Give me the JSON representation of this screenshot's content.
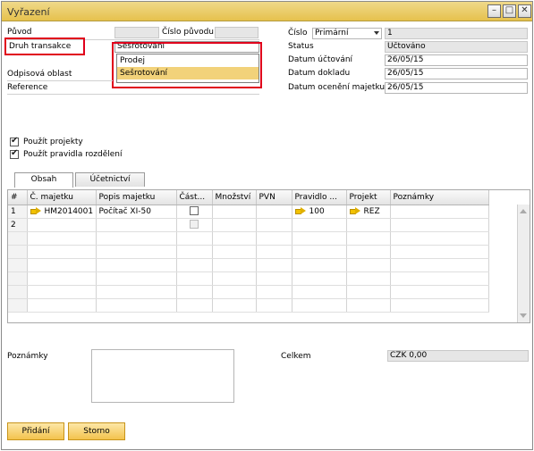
{
  "window": {
    "title": "Vyřazení"
  },
  "header": {
    "puvod_label": "Původ",
    "cislo_puvodu_label": "Číslo původu",
    "druh_transakce_label": "Druh transakce",
    "druh_transakce_value": "Sešrotování",
    "odpisova_oblast_label": "Odpisová oblast",
    "reference_label": "Reference",
    "cislo_label": "Číslo",
    "cislo_series": "Primární",
    "cislo_value": "1",
    "status_label": "Status",
    "status_value": "Účtováno",
    "datum_uctovani_label": "Datum účtování",
    "datum_uctovani_value": "26/05/15",
    "datum_dokladu_label": "Datum dokladu",
    "datum_dokladu_value": "26/05/15",
    "datum_oceneni_label": "Datum ocenění majetku",
    "datum_oceneni_value": "26/05/15"
  },
  "dropdown": {
    "options": [
      "Prodej",
      "Sešrotování"
    ],
    "selected": "Sešrotování"
  },
  "checkboxes": {
    "use_projects": "Použít projekty",
    "use_distribution": "Použít pravidla rozdělení"
  },
  "tabs": [
    "Obsah",
    "Účetnictví"
  ],
  "grid": {
    "columns": [
      "#",
      "Č. majetku",
      "Popis majetku",
      "Část...",
      "Množství",
      "PVN",
      "Pravidlo ...",
      "Projekt",
      "Poznámky"
    ],
    "rows": [
      {
        "num": "1",
        "asset_no": "HM2014001",
        "desc": "Počítač XI-50",
        "rule": "100",
        "project": "REZ"
      },
      {
        "num": "2",
        "asset_no": "",
        "desc": "",
        "rule": "",
        "project": ""
      }
    ]
  },
  "footer": {
    "poznamky_label": "Poznámky",
    "celkem_label": "Celkem",
    "celkem_value": "CZK 0,00"
  },
  "buttons": {
    "add": "Přidání",
    "cancel": "Storno"
  }
}
